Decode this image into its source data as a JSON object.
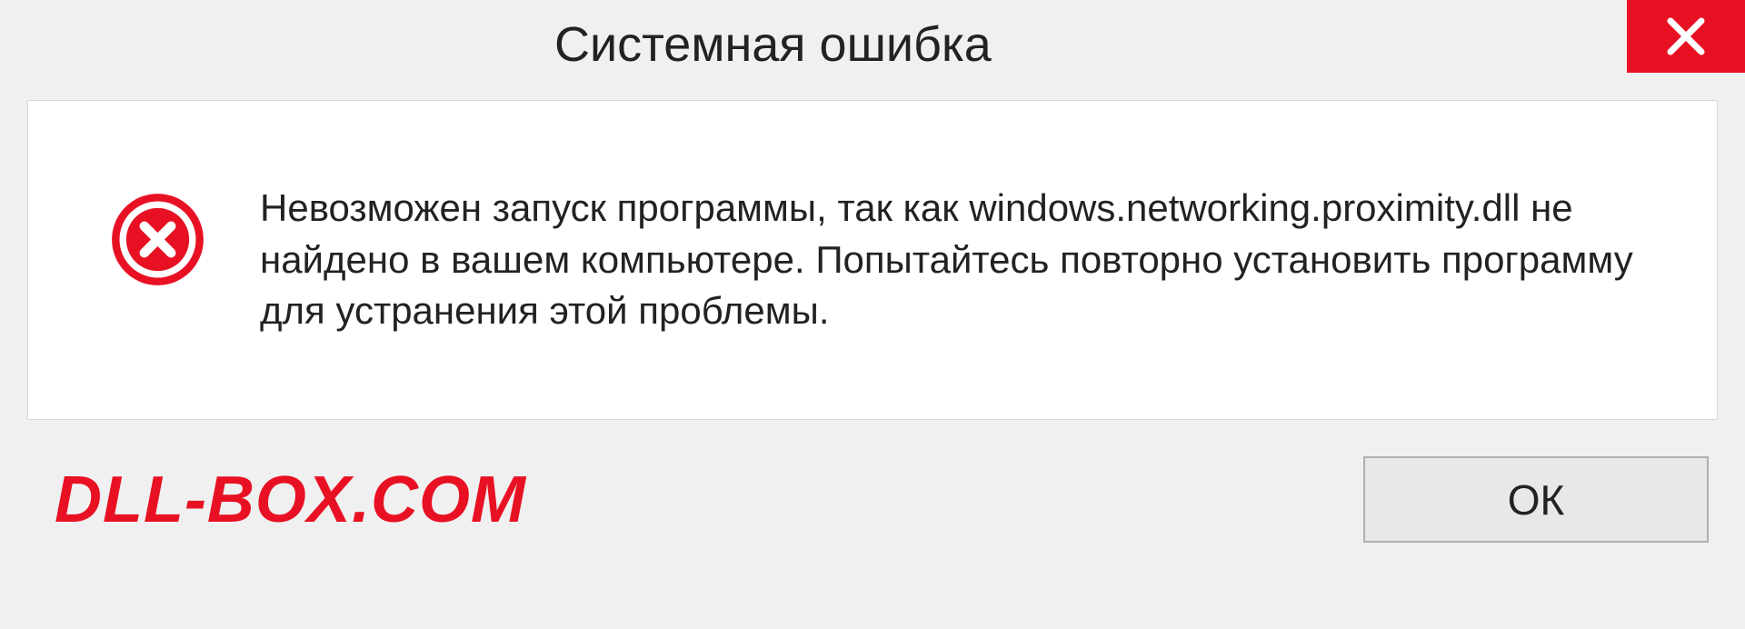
{
  "titlebar": {
    "title": "Системная ошибка"
  },
  "content": {
    "message": "Невозможен запуск программы, так как windows.networking.proximity.dll не найдено в вашем компьютере. Попытайтесь повторно установить программу для устранения этой проблемы."
  },
  "footer": {
    "watermark": "DLL-BOX.COM",
    "ok_label": "ОК"
  },
  "colors": {
    "accent_red": "#e81123",
    "background": "#f0f0f0",
    "panel": "#ffffff"
  }
}
